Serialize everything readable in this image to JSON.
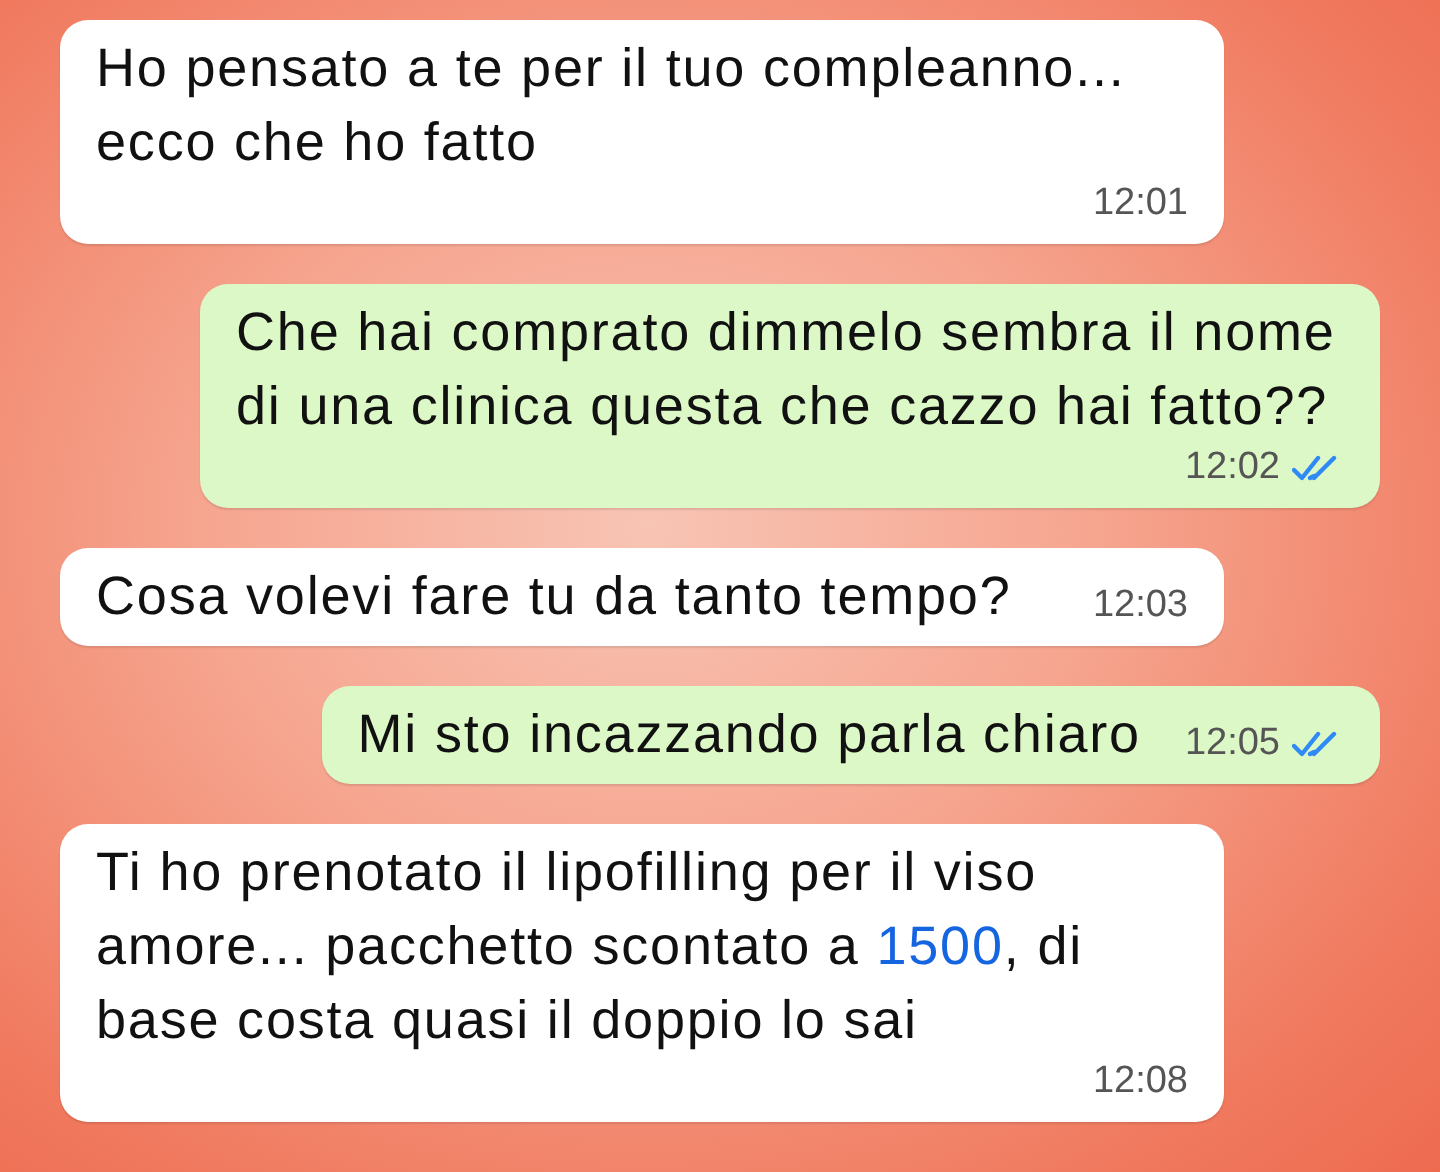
{
  "messages": [
    {
      "kind": "incoming",
      "parts": [
        {
          "kind": "plain",
          "text": "Ho pensato a te per il tuo compleanno... ecco che ho fatto"
        }
      ],
      "time": "12:01"
    },
    {
      "kind": "outgoing",
      "parts": [
        {
          "kind": "plain",
          "text": "Che hai comprato dimmelo sembra il nome di una clinica questa che cazzo hai fatto??"
        }
      ],
      "time": "12:02",
      "read": true
    },
    {
      "kind": "incoming",
      "parts": [
        {
          "kind": "plain",
          "text": "Cosa volevi fare tu da tanto tempo?"
        }
      ],
      "time": "12:03"
    },
    {
      "kind": "outgoing",
      "parts": [
        {
          "kind": "plain",
          "text": "Mi sto incazzando parla chiaro"
        }
      ],
      "time": "12:05",
      "read": true
    },
    {
      "kind": "incoming",
      "parts": [
        {
          "kind": "plain",
          "text": "Ti ho prenotato il lipofilling per il viso amore... pacchetto scontato a "
        },
        {
          "kind": "link",
          "text": "1500"
        },
        {
          "kind": "plain",
          "text": ", di base costa quasi il doppio lo sai"
        }
      ],
      "time": "12:08"
    }
  ]
}
